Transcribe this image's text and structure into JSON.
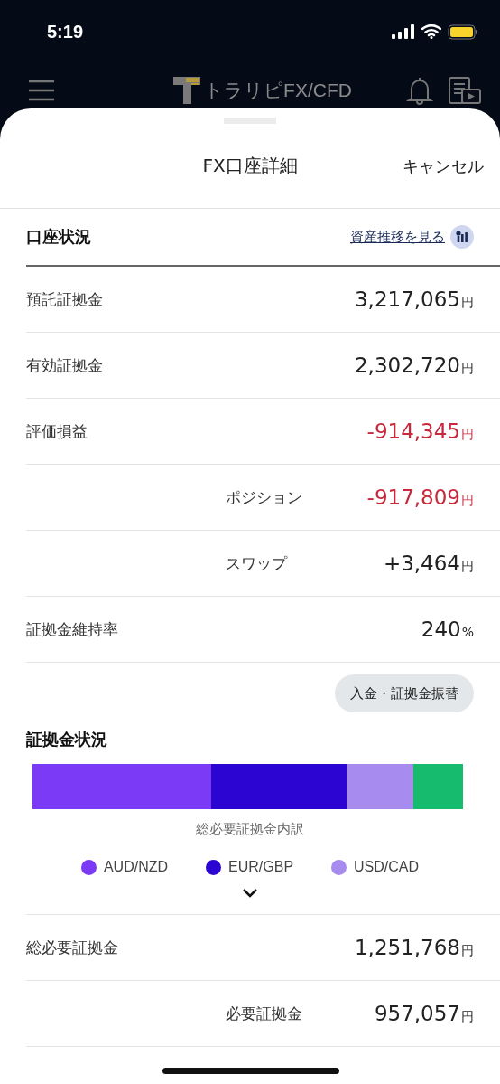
{
  "status_bar": {
    "time": "5:19"
  },
  "app_bar": {
    "logo_text": "トラリピFX/CFD"
  },
  "sheet": {
    "title": "FX口座詳細",
    "cancel": "キャンセル"
  },
  "account_section": {
    "title": "口座状況",
    "link": "資産推移を見る"
  },
  "account_rows": [
    {
      "label": "預託証拠金",
      "value": "3,217,065",
      "unit": "円",
      "negative": false,
      "sub": false
    },
    {
      "label": "有効証拠金",
      "value": "2,302,720",
      "unit": "円",
      "negative": false,
      "sub": false
    },
    {
      "label": "評価損益",
      "value": "-914,345",
      "unit": "円",
      "negative": true,
      "sub": false
    },
    {
      "label": "ポジション",
      "value": "-917,809",
      "unit": "円",
      "negative": true,
      "sub": true
    },
    {
      "label": "スワップ",
      "value": "+3,464",
      "unit": "円",
      "negative": false,
      "sub": true
    },
    {
      "label": "証拠金維持率",
      "value": "240",
      "unit": "%",
      "negative": false,
      "sub": false
    }
  ],
  "transfer_button": "入金・証拠金振替",
  "margin_section": {
    "title": "証拠金状況",
    "caption": "総必要証拠金内訳",
    "legend": [
      {
        "label": "AUD/NZD",
        "color": "#7b3af5"
      },
      {
        "label": "EUR/GBP",
        "color": "#2c05d2"
      },
      {
        "label": "USD/CAD",
        "color": "#a78bef"
      }
    ]
  },
  "margin_rows": [
    {
      "label": "総必要証拠金",
      "value": "1,251,768",
      "unit": "円",
      "negative": false,
      "sub": false
    },
    {
      "label": "必要証拠金",
      "value": "957,057",
      "unit": "円",
      "negative": false,
      "sub": true
    }
  ]
}
